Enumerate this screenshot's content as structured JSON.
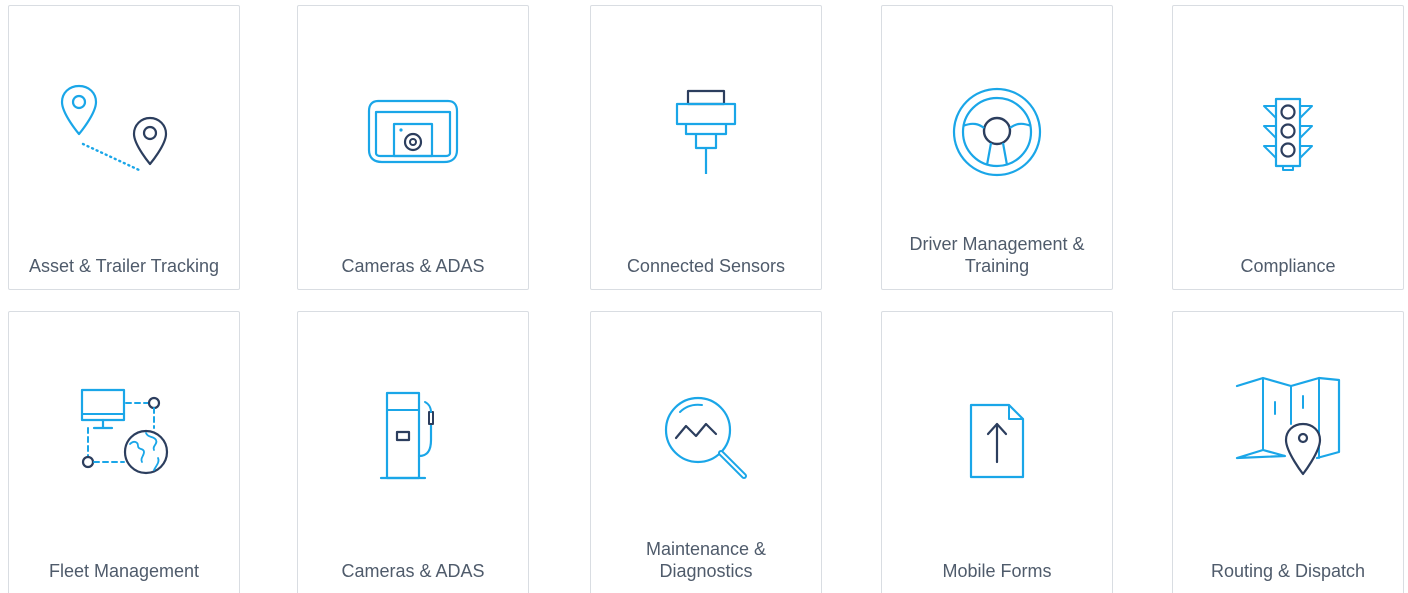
{
  "colors": {
    "accent": "#1aa6e8",
    "dark": "#2c3e5e",
    "text": "#4f5b6b",
    "border": "#d9dde2"
  },
  "cards": [
    {
      "label": "Asset & Trailer Tracking",
      "icon": "map-pins-icon"
    },
    {
      "label": "Cameras & ADAS",
      "icon": "dashcam-icon"
    },
    {
      "label": "Connected Sensors",
      "icon": "sensor-connector-icon"
    },
    {
      "label": "Driver Management & Training",
      "icon": "steering-wheel-icon"
    },
    {
      "label": "Compliance",
      "icon": "traffic-light-icon"
    },
    {
      "label": "Fleet Management",
      "icon": "monitor-globe-icon"
    },
    {
      "label": "Cameras & ADAS",
      "icon": "fuel-pump-icon"
    },
    {
      "label": "Maintenance & Diagnostics",
      "icon": "magnifier-chart-icon"
    },
    {
      "label": "Mobile Forms",
      "icon": "document-upload-icon"
    },
    {
      "label": "Routing & Dispatch",
      "icon": "folded-map-pin-icon"
    }
  ]
}
